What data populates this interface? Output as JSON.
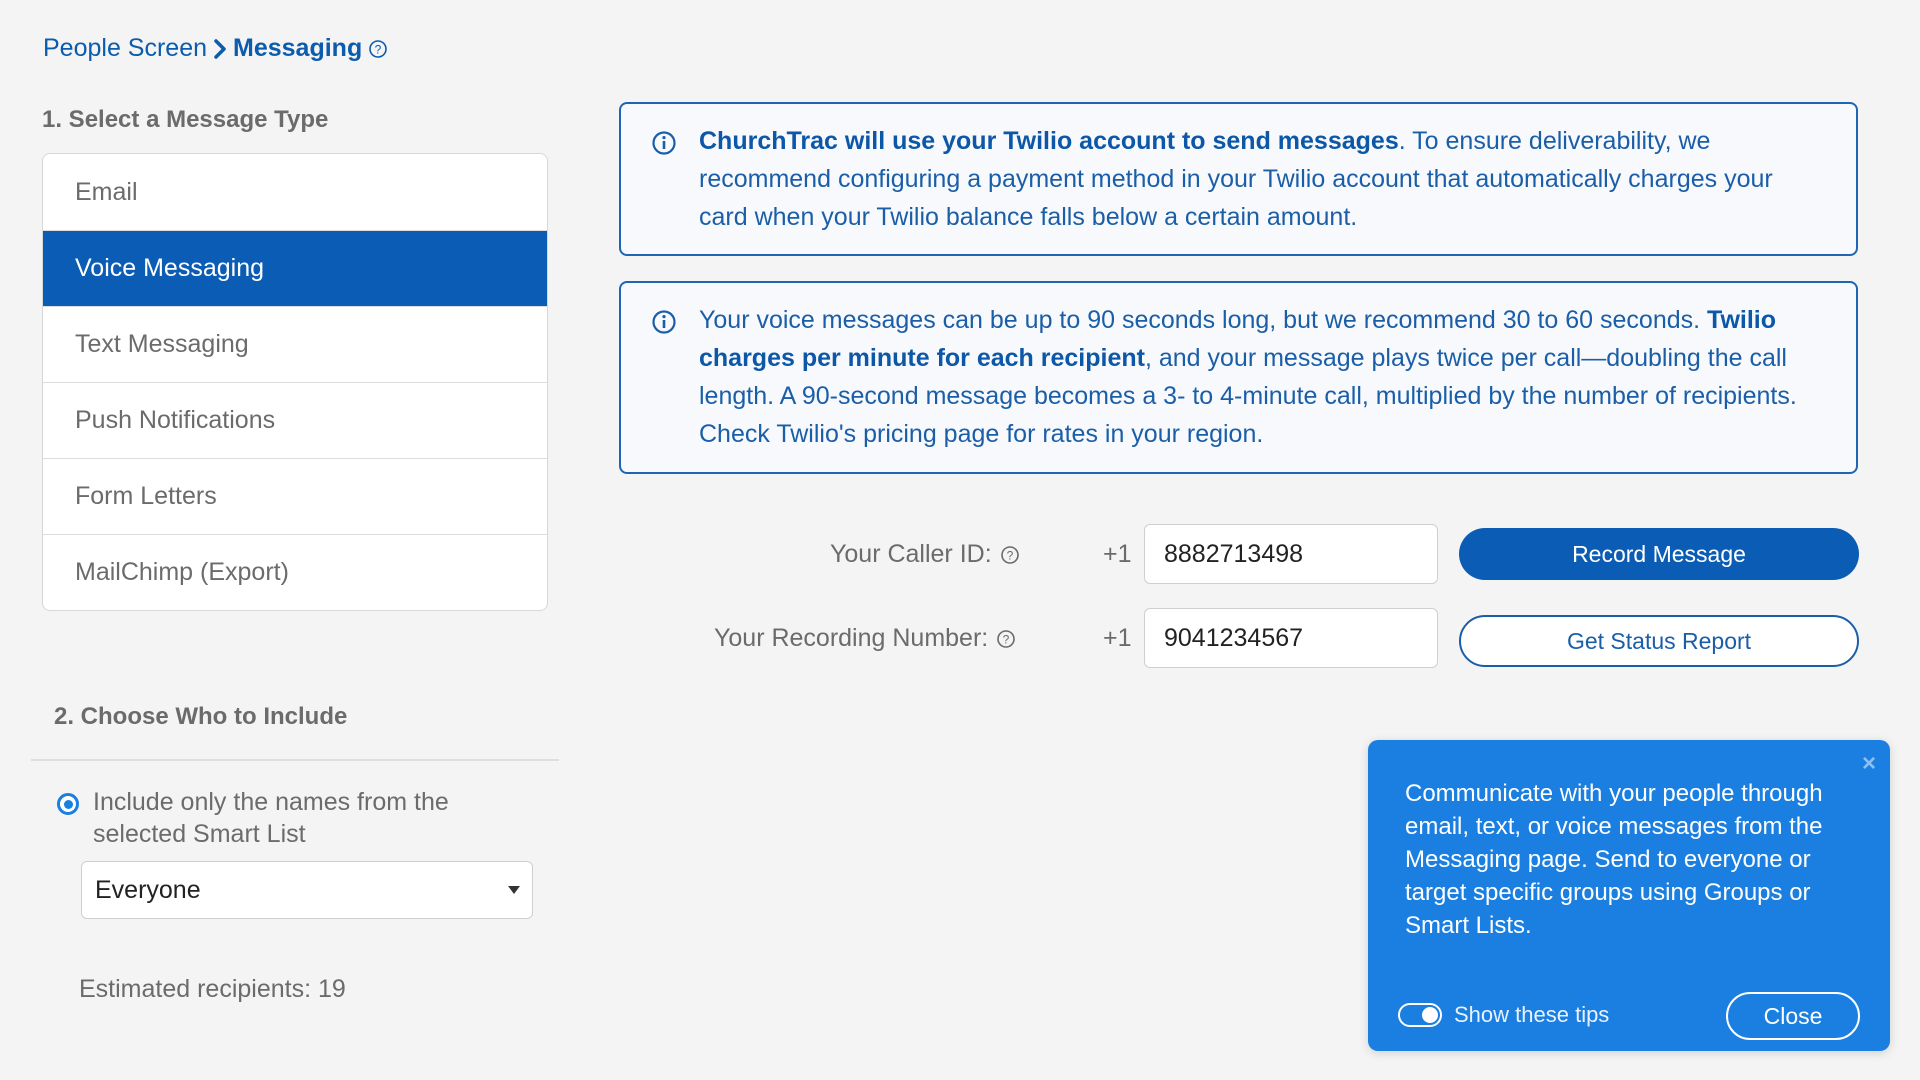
{
  "breadcrumb": {
    "parent": "People Screen",
    "current": "Messaging"
  },
  "section1": {
    "title": "1. Select a Message Type",
    "items": [
      {
        "label": "Email",
        "active": false
      },
      {
        "label": "Voice Messaging",
        "active": true
      },
      {
        "label": "Text Messaging",
        "active": false
      },
      {
        "label": "Push Notifications",
        "active": false
      },
      {
        "label": "Form Letters",
        "active": false
      },
      {
        "label": "MailChimp (Export)",
        "active": false
      }
    ]
  },
  "section2": {
    "title": "2. Choose Who to Include",
    "radio_label": "Include only the names from the selected Smart List",
    "radio_selected": true,
    "smart_list_value": "Everyone",
    "estimate": "Estimated recipients: 19"
  },
  "info1": {
    "bold": "ChurchTrac will use your Twilio account to send messages",
    "rest": ". To ensure deliverability, we recommend configuring a payment method in your Twilio account that automatically charges your card when your Twilio balance falls below a certain amount."
  },
  "info2": {
    "part1": "Your voice messages can be up to 90 seconds long, but we recommend 30 to 60 seconds. ",
    "bold": "Twilio charges per minute for each recipient",
    "part2": ", and your message plays twice per call—doubling the call length. A 90-second message becomes a 3- to 4-minute call, multiplied by the number of recipients. Check Twilio's pricing page for rates in your region."
  },
  "form": {
    "caller_id_label": "Your Caller ID:",
    "caller_prefix": "+1",
    "caller_id_value": "8882713498",
    "recording_label": "Your Recording Number:",
    "recording_prefix": "+1",
    "recording_value": "9041234567",
    "record_button": "Record Message",
    "status_button": "Get Status Report"
  },
  "tips": {
    "text": "Communicate with your people through email, text, or voice messages from the Messaging page. Send to everyone or target specific groups using Groups or Smart Lists.",
    "toggle_label": "Show these tips",
    "toggle_on": true,
    "close_label": "Close",
    "close_x": "×"
  },
  "colors": {
    "primary": "#0b5cb5",
    "tip_bg": "#1a7fe0",
    "page_bg": "#f4f4f4"
  }
}
